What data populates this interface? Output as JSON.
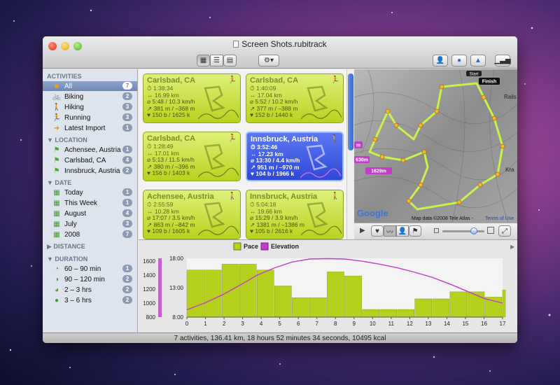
{
  "window": {
    "title": "Screen Shots.rubitrack"
  },
  "sidebar": {
    "activities": {
      "header": "ACTIVITIES",
      "items": [
        {
          "label": "All",
          "count": "7",
          "icon": "folder-icon"
        },
        {
          "label": "Biking",
          "count": "2",
          "icon": "bike-icon"
        },
        {
          "label": "Hiking",
          "count": "3",
          "icon": "hiker-icon"
        },
        {
          "label": "Running",
          "count": "3",
          "icon": "runner-icon"
        },
        {
          "label": "Latest Import",
          "count": "1",
          "icon": "arrow-icon"
        }
      ]
    },
    "location": {
      "header": "LOCATION",
      "items": [
        {
          "label": "Achensee, Austria",
          "count": "1"
        },
        {
          "label": "Carlsbad, CA",
          "count": "4"
        },
        {
          "label": "Innsbruck, Austria",
          "count": "2"
        }
      ]
    },
    "date": {
      "header": "DATE",
      "items": [
        {
          "label": "Today",
          "count": "1"
        },
        {
          "label": "This Week",
          "count": "1"
        },
        {
          "label": "August",
          "count": "4"
        },
        {
          "label": "July",
          "count": "3"
        },
        {
          "label": "2008",
          "count": "7"
        }
      ]
    },
    "distance": {
      "header": "DISTANCE"
    },
    "duration": {
      "header": "DURATION",
      "items": [
        {
          "label": "60 – 90 min",
          "count": "1"
        },
        {
          "label": "90 – 120 min",
          "count": "2"
        },
        {
          "label": "2 – 3 hrs",
          "count": "2"
        },
        {
          "label": "3 – 6 hrs",
          "count": "2"
        }
      ]
    }
  },
  "cards": [
    {
      "title": "Carlsbad, CA",
      "time": "1:38:34",
      "dist": "16.99 km",
      "pace": "5:48 / 10.3 km/h",
      "elev": "381 m / –368 m",
      "hr": "150 b / 1625 k"
    },
    {
      "title": "Carlsbad, CA",
      "time": "1:40:09",
      "dist": "17.04 km",
      "pace": "5:52 / 10.2 km/h",
      "elev": "377 m / –388 m",
      "hr": "152 b / 1440 k"
    },
    {
      "title": "Carlsbad, CA",
      "time": "1:28:49",
      "dist": "17.01 km",
      "pace": "5:13 / 11.5 km/h",
      "elev": "380 m / –396 m",
      "hr": "156 b / 1403 k"
    },
    {
      "title": "Innsbruck, Austria",
      "time": "3:52:46",
      "dist": "17.23 km",
      "pace": "13:30 / 4.4 km/h",
      "elev": "951 m / –970 m",
      "hr": "104 b / 1966 k"
    },
    {
      "title": "Achensee, Austria",
      "time": "2:55:59",
      "dist": "10.28 km",
      "pace": "17:07 / 3.5 km/h",
      "elev": "863 m / –842 m",
      "hr": "109 b / 1605 k"
    },
    {
      "title": "Innsbruck, Austria",
      "time": "5:04:18",
      "dist": "19.66 km",
      "pace": "15:29 / 3.9 km/h",
      "elev": "1381 m / –1386 m",
      "hr": "105 b / 2616 k"
    }
  ],
  "map": {
    "labels": {
      "start": "Start",
      "finish": "Finish",
      "m1": "1629m",
      "m2": "630m",
      "m3": "m",
      "place1": "Rails",
      "place2": "Kra"
    },
    "copyright": "Map data ©2008 Tele Atlas -",
    "terms": "Terms of Use",
    "logo": "Google"
  },
  "chart_data": {
    "type": "bar",
    "legend": [
      "Pace",
      "Elevation"
    ],
    "x": [
      0,
      1,
      2,
      3,
      4,
      5,
      6,
      7,
      8,
      9,
      10,
      11,
      12,
      13,
      14,
      15,
      16,
      17
    ],
    "y_left_ticks": [
      "1600",
      "1400",
      "1200",
      "1000",
      "800"
    ],
    "y_right_ticks": [
      "18:00",
      "13:00",
      "8:00"
    ],
    "pace_minutes": [
      16,
      16,
      17,
      17,
      16,
      13.3,
      11.3,
      11.3,
      15.7,
      15,
      9.3,
      9.3,
      9.3,
      11.1,
      11.1,
      12.3,
      12.3,
      11.4,
      12.6
    ],
    "elevation_m": [
      900,
      990,
      1100,
      1230,
      1370,
      1470,
      1550,
      1590,
      1595,
      1590,
      1560,
      1520,
      1470,
      1410,
      1340,
      1250,
      1150,
      1050,
      990
    ],
    "colors": {
      "pace": "#b5d11c",
      "elevation": "#c23dc9"
    }
  },
  "status": {
    "text": "7 activities, 136.41 km, 18 hours 52 minutes 34 seconds, 10495 kcal"
  }
}
